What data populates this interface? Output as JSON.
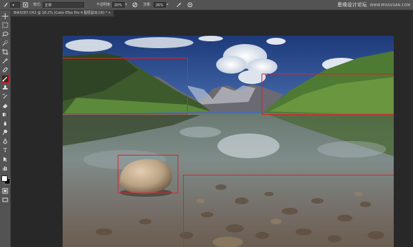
{
  "options_bar": {
    "mode_label": "模式:",
    "mode_value": "正常",
    "opacity_label": "不透明度:",
    "opacity_value": "20%",
    "flow_label": "流量:",
    "flow_value": "26%"
  },
  "watermark": {
    "text": "思缘设计论坛",
    "site": "WWW.MISSVUAN.COM"
  },
  "document": {
    "tab_title": "BIA3287.CR2 @ 18.2% (Color Efex Pro 4 图层副本/16) *",
    "close_glyph": "×"
  },
  "tools": [
    {
      "name": "move-tool-icon"
    },
    {
      "name": "marquee-tool-icon"
    },
    {
      "name": "lasso-tool-icon"
    },
    {
      "name": "quick-selection-tool-icon"
    },
    {
      "name": "crop-tool-icon"
    },
    {
      "name": "eyedropper-tool-icon"
    },
    {
      "name": "healing-brush-tool-icon"
    },
    {
      "name": "brush-tool-icon"
    },
    {
      "name": "clone-stamp-tool-icon"
    },
    {
      "name": "history-brush-tool-icon"
    },
    {
      "name": "eraser-tool-icon"
    },
    {
      "name": "gradient-tool-icon"
    },
    {
      "name": "blur-tool-icon"
    },
    {
      "name": "dodge-tool-icon"
    },
    {
      "name": "pen-tool-icon"
    },
    {
      "name": "type-tool-icon"
    },
    {
      "name": "path-selection-tool-icon"
    },
    {
      "name": "shape-tool-icon"
    },
    {
      "name": "hand-tool-icon"
    },
    {
      "name": "zoom-tool-icon"
    }
  ],
  "colors": {
    "selection_stroke": "#d8232a",
    "foreground": "#ffffff",
    "background": "#000000"
  }
}
